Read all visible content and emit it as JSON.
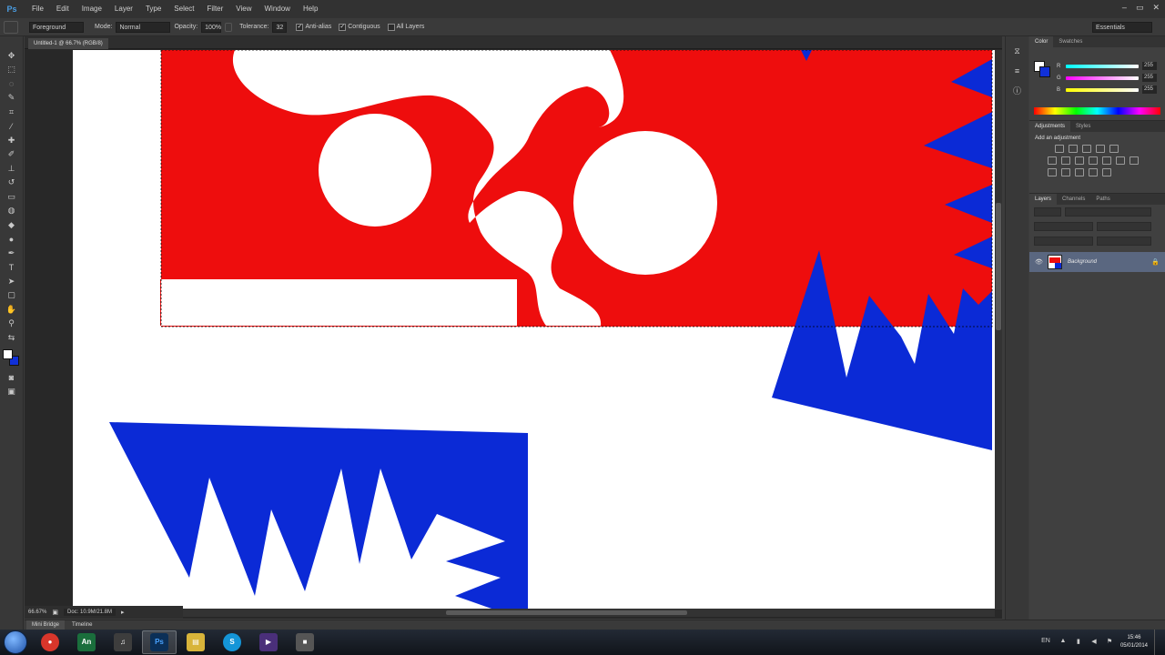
{
  "app": {
    "logo": "Ps",
    "menu": [
      "File",
      "Edit",
      "Image",
      "Layer",
      "Type",
      "Select",
      "Filter",
      "View",
      "Window",
      "Help"
    ],
    "window_controls": [
      "–",
      "▭",
      "✕"
    ]
  },
  "options_bar": {
    "preset": "Foreground",
    "mode_label": "Mode:",
    "mode_value": "Normal",
    "opacity_label": "Opacity:",
    "opacity_value": "100%",
    "tolerance_label": "Tolerance:",
    "tolerance_value": "32",
    "antialias_label": "Anti-alias",
    "contiguous_label": "Contiguous",
    "all_layers_label": "All Layers",
    "workspace": "Essentials"
  },
  "document": {
    "tab_title": "Untitled-1 @ 66.7% (RGB/8)",
    "zoom": "66.67%",
    "doc_size": "Doc: 10.9M/21.8M"
  },
  "canvas_colors": {
    "red": "#ee0d0d",
    "blue": "#0b2ad6",
    "white": "#ffffff"
  },
  "right_panels": {
    "color_tabs": [
      "Color",
      "Swatches"
    ],
    "sliders": [
      {
        "letter": "R",
        "value": "255",
        "gradient": "linear-gradient(to right, #00ffff, #ffffff)"
      },
      {
        "letter": "G",
        "value": "255",
        "gradient": "linear-gradient(to right, #ff00ff, #ffffff)"
      },
      {
        "letter": "B",
        "value": "255",
        "gradient": "linear-gradient(to right, #ffff00, #ffffff)"
      }
    ],
    "adjustment_tabs": [
      "Adjustments",
      "Styles"
    ],
    "adjustment_title": "Add an adjustment",
    "layers_tabs": [
      "Layers",
      "Channels",
      "Paths"
    ],
    "layer_name": "Background"
  },
  "bottom_tabs": [
    "Mini Bridge",
    "Timeline"
  ],
  "taskbar": {
    "apps": [
      {
        "name": "chrome",
        "glyph": "●",
        "color": "#d8362b"
      },
      {
        "name": "animate",
        "glyph": "An",
        "color": "#1a6e3c"
      },
      {
        "name": "itunes",
        "glyph": "♫",
        "color": "#3d3d3d"
      },
      {
        "name": "photoshop",
        "glyph": "Ps",
        "color": "#0b2f57"
      },
      {
        "name": "explorer",
        "glyph": "▤",
        "color": "#d8b43a"
      },
      {
        "name": "skype",
        "glyph": "S",
        "color": "#1495d8"
      },
      {
        "name": "media",
        "glyph": "▶",
        "color": "#4a2f7a"
      },
      {
        "name": "app",
        "glyph": "■",
        "color": "#555555"
      }
    ],
    "language": "EN",
    "time": "15:46",
    "date": "05/01/2014"
  }
}
